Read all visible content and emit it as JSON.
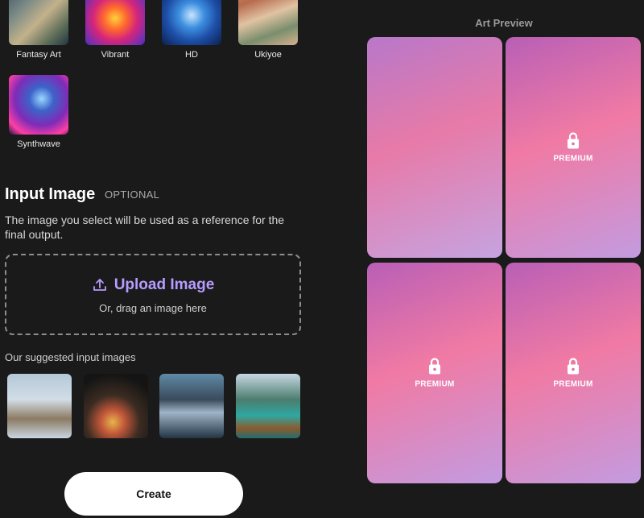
{
  "styles": [
    {
      "label": "Fantasy Art",
      "icon": "fantasy-art-thumbnail"
    },
    {
      "label": "Vibrant",
      "icon": "vibrant-thumbnail"
    },
    {
      "label": "HD",
      "icon": "hd-thumbnail"
    },
    {
      "label": "Ukiyoe",
      "icon": "ukiyoe-thumbnail"
    },
    {
      "label": "Synthwave",
      "icon": "synthwave-thumbnail"
    }
  ],
  "input_image": {
    "title": "Input Image",
    "optional": "OPTIONAL",
    "description": "The image you select will be used as a reference for the final output.",
    "upload_label": "Upload Image",
    "upload_hint": "Or, drag an image here",
    "upload_icon": "upload-icon",
    "accent": "#b79cff"
  },
  "suggested": {
    "title": "Our suggested input images",
    "items": [
      {
        "icon": "owl-photo"
      },
      {
        "icon": "food-bowl-photo"
      },
      {
        "icon": "escalator-tunnel-photo"
      },
      {
        "icon": "boat-lake-photo"
      }
    ]
  },
  "create_button": {
    "label": "Create"
  },
  "art_preview": {
    "title": "Art Preview",
    "cards": [
      {
        "locked": false,
        "label": ""
      },
      {
        "locked": true,
        "label": "PREMIUM"
      },
      {
        "locked": true,
        "label": "PREMIUM"
      },
      {
        "locked": true,
        "label": "PREMIUM"
      }
    ]
  }
}
